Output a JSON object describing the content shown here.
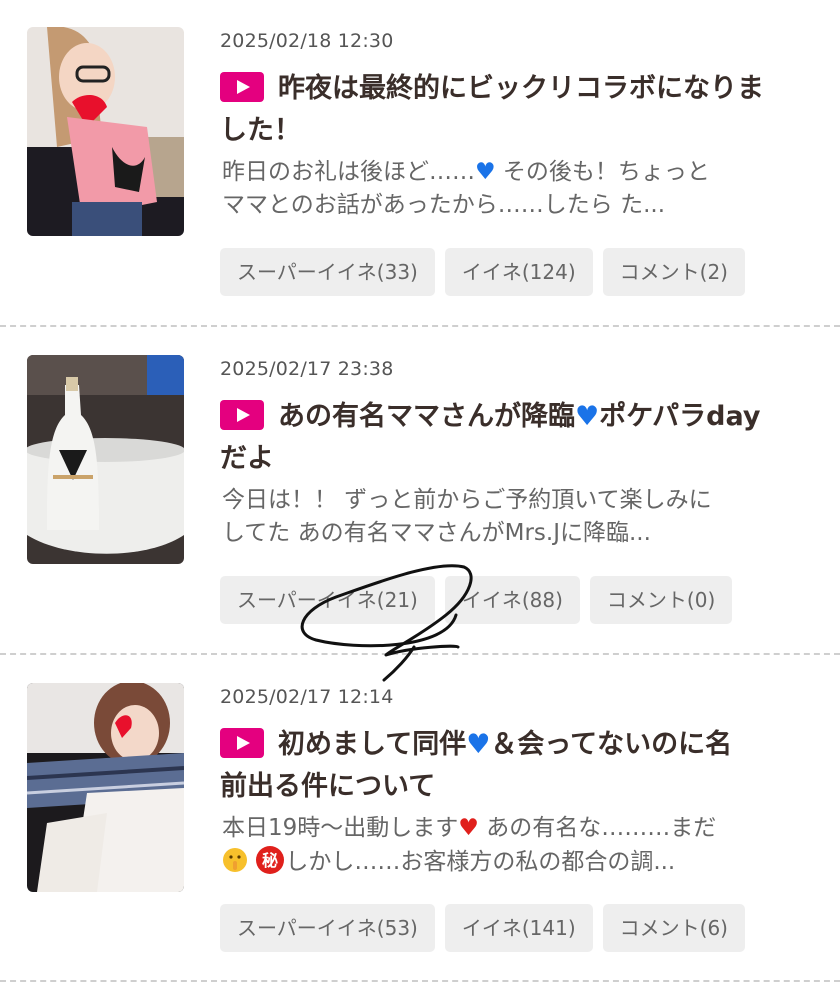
{
  "posts": [
    {
      "date": "2025/02/18 12:30",
      "title_a": "昨夜は最終的にビックリコラボになりま",
      "title_b": "した！",
      "excerpt_a1": " 昨日のお礼は後ほど……",
      "excerpt_a2": " その後も！ちょっと",
      "excerpt_b": "ママとのお話があったから……したら た...",
      "buttons": {
        "super_like": "スーパーイイネ(33)",
        "like": "イイネ(124)",
        "comment": "コメント(2)"
      }
    },
    {
      "date": "2025/02/17 23:38",
      "title_a1": "あの有名ママさんが降臨",
      "title_a2": "ポケパラday",
      "title_b": "だよ",
      "excerpt_a": "今日は！！ ずっと前からご予約頂いて楽しみに",
      "excerpt_b": "してた あの有名ママさんがMrs.Jに降臨...",
      "buttons": {
        "super_like": "スーパーイイネ(21)",
        "like": "イイネ(88)",
        "comment": "コメント(0)"
      }
    },
    {
      "date": "2025/02/17 12:14",
      "title_a1": "初めまして同伴",
      "title_a2": "＆会ってないのに名",
      "title_b": "前出る件について",
      "excerpt_a1": " 本日19時〜出動します",
      "excerpt_a2": " あの有名な………まだ",
      "excerpt_b": "しかし……お客様方の私の都合の調...",
      "buttons": {
        "super_like": "スーパーイイネ(53)",
        "like": "イイネ(141)",
        "comment": "コメント(6)"
      }
    }
  ],
  "icons": {
    "play": "play-icon",
    "heart_blue": "blue-heart-icon",
    "heart_red": "red-heart-icon",
    "shush": "shushing-face-icon",
    "secret": "secret-icon"
  },
  "secret_glyph": "秘",
  "colors": {
    "accent": "#e4007f",
    "title": "#3a2e2a",
    "button_bg": "#eeeeee"
  }
}
